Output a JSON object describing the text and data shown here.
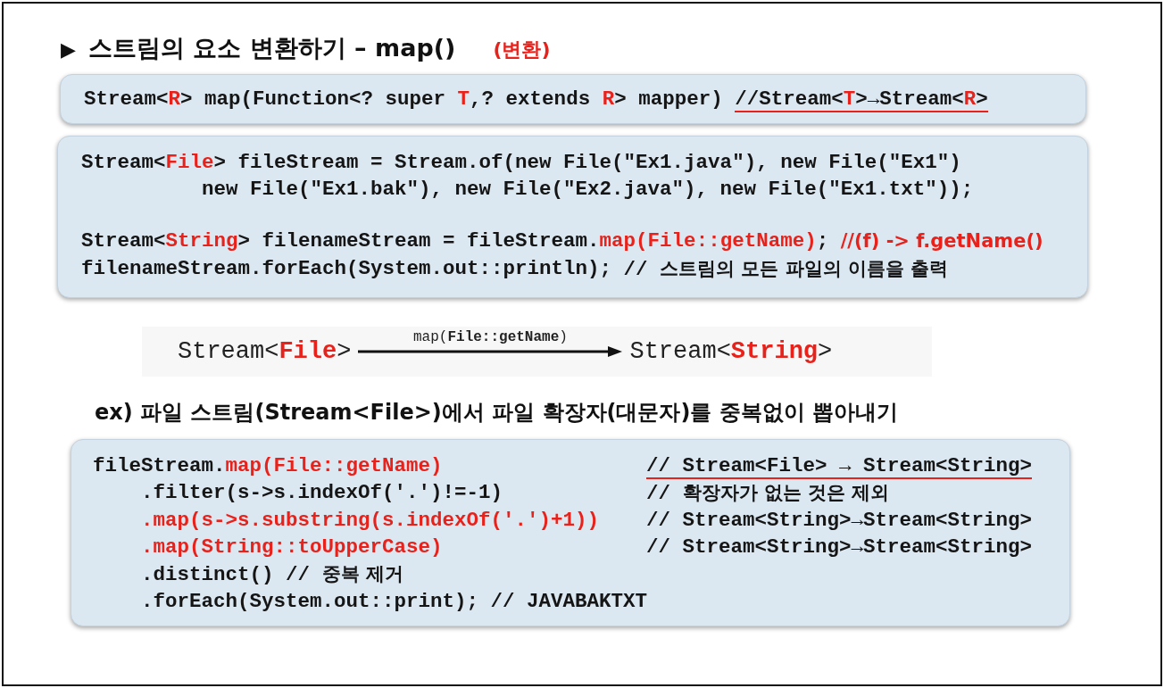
{
  "title": {
    "marker": "▶",
    "text": "스트림의 요소 변환하기 –  map()",
    "note": "(변환)"
  },
  "signature_box": {
    "lines": [
      {
        "code": [
          {
            "text": "Stream<",
            "kind": "code"
          },
          {
            "text": "R",
            "kind": "code-red"
          },
          {
            "text": "> map(Function<? super ",
            "kind": "code"
          },
          {
            "text": "T",
            "kind": "code-red"
          },
          {
            "text": ",? extends ",
            "kind": "code"
          },
          {
            "text": "R",
            "kind": "code-red"
          },
          {
            "text": "> mapper) ",
            "kind": "code"
          }
        ],
        "comment": {
          "underlined": true,
          "segments": [
            {
              "text": "//Stream<",
              "kind": "code"
            },
            {
              "text": "T",
              "kind": "code-red"
            },
            {
              "text": ">→Stream<",
              "kind": "code"
            },
            {
              "text": "R",
              "kind": "code-red"
            },
            {
              "text": ">",
              "kind": "code"
            }
          ]
        }
      }
    ]
  },
  "example_box": {
    "groups": [
      [
        {
          "code": [
            {
              "text": "Stream<",
              "kind": "code"
            },
            {
              "text": "File",
              "kind": "code-red"
            },
            {
              "text": "> fileStream = Stream.of(new File(\"Ex1.java\"), new File(\"Ex1\")",
              "kind": "code"
            }
          ],
          "children": [
            {
              "code": [
                {
                  "text": "new File(\"Ex1.bak\"), new File(\"Ex2.java\"), new File(\"Ex1.txt\"));",
                  "kind": "code"
                }
              ]
            }
          ]
        }
      ],
      [
        {
          "code": [
            {
              "text": "Stream<",
              "kind": "code"
            },
            {
              "text": "String",
              "kind": "code-red"
            },
            {
              "text": "> filenameStream = fileStream.",
              "kind": "code"
            },
            {
              "text": "map(File::getName)",
              "kind": "code-red"
            },
            {
              "text": "; ",
              "kind": "code"
            }
          ],
          "comment": {
            "underlined": false,
            "segments": [
              {
                "text": "//(f) -> f.getName()",
                "kind": "sans-red"
              }
            ]
          }
        },
        {
          "code": [
            {
              "text": "filenameStream.forEach(System.out::println); ",
              "kind": "code"
            }
          ],
          "comment": {
            "underlined": false,
            "segments": [
              {
                "text": "// ",
                "kind": "code"
              },
              {
                "text": "스트림의 모든 파일의 이름을 출력",
                "kind": "sans"
              }
            ]
          }
        }
      ]
    ]
  },
  "diagram": {
    "source": [
      {
        "text": "Stream<",
        "kind": "plain"
      },
      {
        "text": "File",
        "kind": "red"
      },
      {
        "text": ">",
        "kind": "plain"
      }
    ],
    "arrow_label": [
      {
        "text": "map(",
        "kind": "plain"
      },
      {
        "text": "File::getName",
        "kind": "bold"
      },
      {
        "text": ")",
        "kind": "plain"
      }
    ],
    "target": [
      {
        "text": "Stream<",
        "kind": "plain"
      },
      {
        "text": "String",
        "kind": "red"
      },
      {
        "text": ">",
        "kind": "plain"
      }
    ]
  },
  "exercise": {
    "heading": "ex) 파일 스트림(Stream<File>)에서 파일 확장자(대문자)를 중복없이 뽑아내기",
    "lines": [
      {
        "code": [
          {
            "text": "fileStream.",
            "kind": "code"
          },
          {
            "text": "map(File::getName)",
            "kind": "code-red"
          }
        ],
        "comment": {
          "underlined": true,
          "segments": [
            {
              "text": "// ",
              "kind": "code"
            },
            {
              "text": "Stream<File> → Stream<String>",
              "kind": "code"
            }
          ]
        },
        "children": [
          {
            "code": [
              {
                "text": ".filter(s->s.indexOf('.')!=-1)",
                "kind": "code"
              }
            ],
            "comment": {
              "underlined": false,
              "segments": [
                {
                  "text": "// ",
                  "kind": "code"
                },
                {
                  "text": "확장자가 없는 것은 제외",
                  "kind": "sans"
                }
              ]
            }
          },
          {
            "code": [
              {
                "text": ".map(s->s.substring(s.indexOf('.')+1))",
                "kind": "code-red"
              }
            ],
            "comment": {
              "underlined": false,
              "segments": [
                {
                  "text": "// Stream<String>→Stream<String>",
                  "kind": "code"
                }
              ]
            }
          },
          {
            "code": [
              {
                "text": ".map(String::toUpperCase)",
                "kind": "code-red"
              }
            ],
            "comment": {
              "underlined": false,
              "segments": [
                {
                  "text": "// Stream<String>→Stream<String>",
                  "kind": "code"
                }
              ]
            }
          },
          {
            "code": [
              {
                "text": ".distinct() // ",
                "kind": "code"
              },
              {
                "text": "중복 제거",
                "kind": "sans"
              }
            ]
          },
          {
            "code": [
              {
                "text": ".forEach(System.out::print); // JAVABAKTXT",
                "kind": "code"
              }
            ]
          }
        ]
      }
    ]
  }
}
